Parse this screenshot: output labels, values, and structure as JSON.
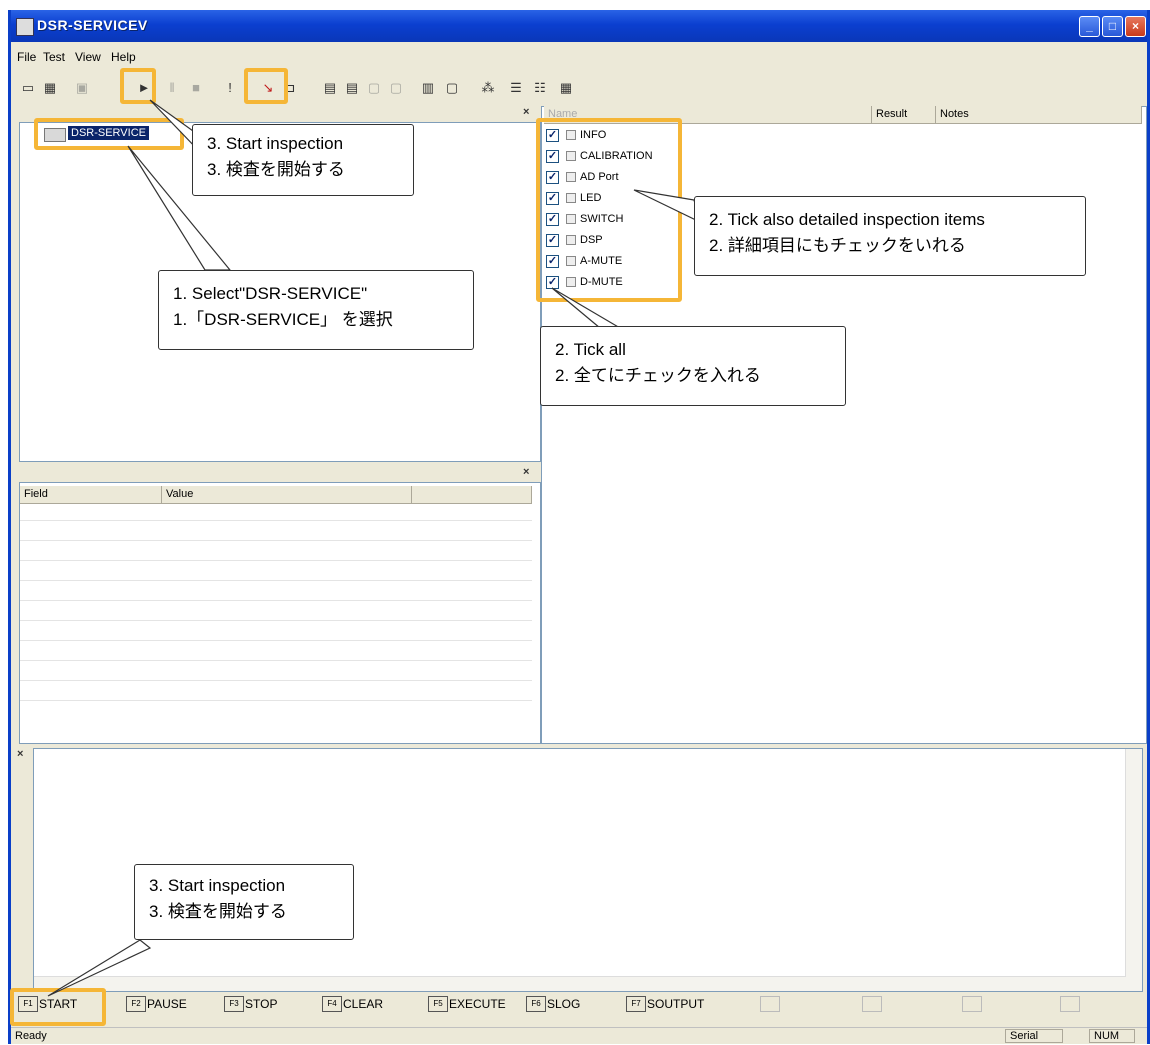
{
  "window": {
    "title": "DSR-SERVICEV"
  },
  "menu": [
    "File",
    "Test",
    "View",
    "Help"
  ],
  "tree": {
    "node_label": "DSR-SERVICE"
  },
  "detail_table": {
    "columns": [
      "Field",
      "Value",
      ""
    ]
  },
  "list": {
    "columns": [
      "Name",
      "Result",
      "Notes"
    ],
    "items": [
      "INFO",
      "CALIBRATION",
      "AD Port",
      "LED",
      "SWITCH",
      "DSP",
      "A-MUTE",
      "D-MUTE"
    ],
    "checked_glyph": "✓"
  },
  "callouts": {
    "start_top": {
      "en": "3. Start inspection",
      "ja": "3. 検査を開始する"
    },
    "select": {
      "en": "1. Select\"DSR-SERVICE\"",
      "ja": "1.「DSR-SERVICE」 を選択"
    },
    "detail": {
      "en": "2. Tick also detailed inspection items",
      "ja": "2. 詳細項目にもチェックをいれる"
    },
    "tick_all": {
      "en": "2. Tick all",
      "ja": "2. 全てにチェックを入れる"
    },
    "start_bottom": {
      "en": "3. Start inspection",
      "ja": "3. 検査を開始する"
    }
  },
  "function_keys": [
    {
      "key": "F1",
      "label": "START"
    },
    {
      "key": "F2",
      "label": "PAUSE"
    },
    {
      "key": "F3",
      "label": "STOP"
    },
    {
      "key": "F4",
      "label": "CLEAR"
    },
    {
      "key": "F5",
      "label": "EXECUTE"
    },
    {
      "key": "F6",
      "label": "SLOG"
    },
    {
      "key": "F7",
      "label": "SOUTPUT"
    }
  ],
  "status": {
    "text": "Ready",
    "serial": "Serial",
    "num": "NUM"
  },
  "pane_close_glyph": "×",
  "colors": {
    "highlight": "#f5b637",
    "titlebar": "#0b3fd0",
    "selection": "#0a246a"
  }
}
